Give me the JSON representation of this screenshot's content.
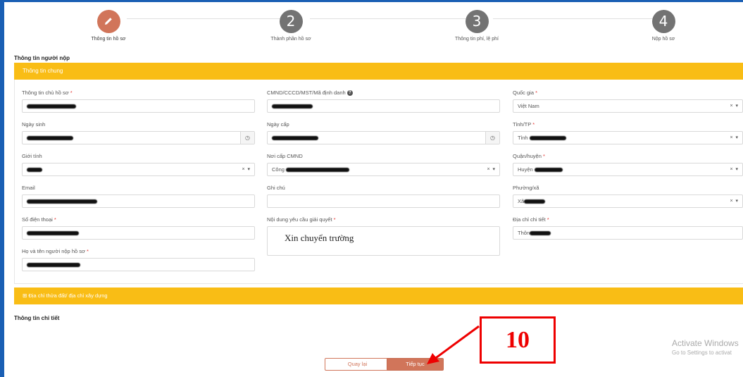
{
  "stepper": {
    "steps": [
      {
        "number": "",
        "label": "Thông tin hồ sơ",
        "icon": "pencil-icon"
      },
      {
        "number": "2",
        "label": "Thành phần hồ sơ"
      },
      {
        "number": "3",
        "label": "Thông tin phí, lệ phí"
      },
      {
        "number": "4",
        "label": "Nộp hồ sơ"
      }
    ]
  },
  "applicant_section_title": "Thông tin người nộp",
  "general_bar_label": "Thông tin chung",
  "form": {
    "owner_name_label": "Thông tin chủ hồ sơ",
    "id_number_label": "CMND/CCCD/MST/Mã định danh",
    "country_label": "Quốc gia",
    "country_value": "Việt Nam",
    "birth_date_label": "Ngày sinh",
    "issue_date_label": "Ngày cấp",
    "province_label": "Tỉnh/TP",
    "province_value_prefix": "Tỉnh",
    "gender_label": "Giới tính",
    "issue_place_label": "Nơi cấp CMND",
    "issue_place_value_prefix": "Công",
    "district_label": "Quận/huyện",
    "district_value_prefix": "Huyện",
    "email_label": "Email",
    "note_label": "Ghi chú",
    "ward_label": "Phường/xã",
    "ward_value_prefix": "Xã",
    "phone_label": "Số điện thoại",
    "request_label": "Nội dung yêu cầu giải quyết",
    "request_value": "Xin chuyển trường",
    "address_label": "Địa chỉ chi tiết",
    "address_value_prefix": "Thôn",
    "submitter_name_label": "Họ và tên người nộp hồ sơ",
    "required_mark": "*",
    "clear_symbol": "×",
    "dropdown_symbol": "▾",
    "clock_symbol": "◷"
  },
  "land_address_bar_label": "Địa chỉ thửa đất/ địa chỉ xây dựng",
  "land_address_toggle": "⊞",
  "detail_section_title": "Thông tin chi tiết",
  "buttons": {
    "back": "Quay lại",
    "next": "Tiếp tục"
  },
  "annotation": {
    "label": "10",
    "color": "#e00000"
  },
  "watermark": {
    "line1": "Activate Windows",
    "line2": "Go to Settings to activat"
  },
  "colors": {
    "accent": "#d1755a",
    "bar": "#f9bd15",
    "step_inactive": "#737373",
    "frame": "#1a5fb4"
  }
}
